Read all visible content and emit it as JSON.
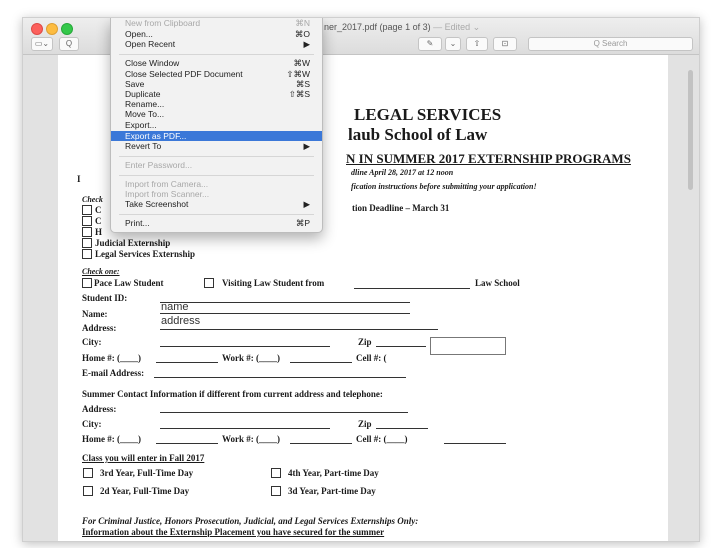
{
  "window": {
    "title": "ner_2017.pdf (page 1 of 3)",
    "title_status": "— Edited ⌄",
    "search_placeholder": "Q Search",
    "sidebar_btn": "▭⌄",
    "zoom_btn": "Q",
    "pen_btn": "✎",
    "pen_menu": "⌄",
    "share_btn": "⇧",
    "toolbox_btn": "⊡"
  },
  "menu": {
    "items": [
      {
        "label": "New from Clipboard",
        "shortcut": "⌘N",
        "disabled": true
      },
      {
        "label": "Open...",
        "shortcut": "⌘O"
      },
      {
        "label": "Open Recent",
        "shortcut": "▶"
      },
      {
        "label": "Close Window",
        "shortcut": "⌘W"
      },
      {
        "label": "Close Selected PDF Document",
        "shortcut": "⇧⌘W"
      },
      {
        "label": "Save",
        "shortcut": "⌘S"
      },
      {
        "label": "Duplicate",
        "shortcut": "⇧⌘S"
      },
      {
        "label": "Rename...",
        "shortcut": ""
      },
      {
        "label": "Move To...",
        "shortcut": ""
      },
      {
        "label": "Export...",
        "shortcut": ""
      },
      {
        "label": "Export as PDF...",
        "shortcut": "",
        "selected": true
      },
      {
        "label": "Revert To",
        "shortcut": "▶"
      },
      {
        "label": "Enter Password...",
        "shortcut": "",
        "disabled": true
      },
      {
        "label": "Import from Camera...",
        "shortcut": "",
        "disabled": true
      },
      {
        "label": "Import from Scanner...",
        "shortcut": "",
        "disabled": true
      },
      {
        "label": "Take Screenshot",
        "shortcut": "▶"
      },
      {
        "label": "Print...",
        "shortcut": "⌘P"
      }
    ]
  },
  "doc": {
    "heading1": "LEGAL SERVICES",
    "heading2": "laub School of Law",
    "heading3": "N IN SUMMER 2017 EXTERNSHIP PROGRAMS",
    "deadline": "dline April 28, 2017 at 12 noon",
    "instructions": "fication instructions before submitting your application!",
    "app_deadline": "tion Deadline – March 31",
    "left_letter": "I",
    "check_label": "Check",
    "box_letters": [
      "C",
      "C",
      "H"
    ],
    "judicial": "Judicial Externship",
    "legal_services": "Legal Services Externship",
    "check_one": "Check one:",
    "pace_student": "Pace Law Student",
    "visiting": "Visiting Law Student from",
    "law_school": "Law School",
    "student_id": "Student ID:",
    "name_label": "Name:",
    "name_value": "name",
    "address_label": "Address:",
    "address_value": "address",
    "city_label": "City:",
    "zip_label": "Zip",
    "home_label": "Home #: (____)",
    "work_label": "Work #: (____)",
    "cell_label": "Cell #: (",
    "email_label": "E-mail Address:",
    "summer_contact": "Summer Contact Information if different from current address and telephone:",
    "address2_label": "Address:",
    "city2_label": "City:",
    "zip2_label": "Zip",
    "home2_label": "Home #: (____)",
    "work2_label": "Work #: (____)",
    "cell2_label": "Cell #: (____)",
    "class_heading": "Class you will enter in Fall 2017",
    "class_options": [
      "3rd Year, Full-Time Day",
      "4th Year, Part-time Day",
      "2d Year, Full-Time Day",
      "3d Year, Part-time Day"
    ],
    "footer_italic": "For Criminal Justice, Honors Prosecution, Judicial, and Legal Services Externships Only:",
    "footer_underline": "Information about the Externship Placement you have secured for the summer"
  }
}
